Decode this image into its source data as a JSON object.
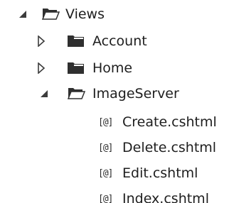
{
  "tree": {
    "views": {
      "label": "Views",
      "expanded": true,
      "icon": "open-folder-icon"
    },
    "account": {
      "label": "Account",
      "expanded": false,
      "icon": "folder-icon"
    },
    "home": {
      "label": "Home",
      "expanded": false,
      "icon": "folder-icon"
    },
    "imageserver": {
      "label": "ImageServer",
      "expanded": true,
      "icon": "open-folder-icon",
      "files": [
        {
          "label": "Create.cshtml",
          "icon_text": "[@]"
        },
        {
          "label": "Delete.cshtml",
          "icon_text": "[@]"
        },
        {
          "label": "Edit.cshtml",
          "icon_text": "[@]"
        },
        {
          "label": "Index.cshtml",
          "icon_text": "[@]"
        }
      ]
    }
  },
  "colors": {
    "text": "#1e1e1e",
    "folder": "#2f2f2f",
    "arrow": "#3c3c3c"
  }
}
